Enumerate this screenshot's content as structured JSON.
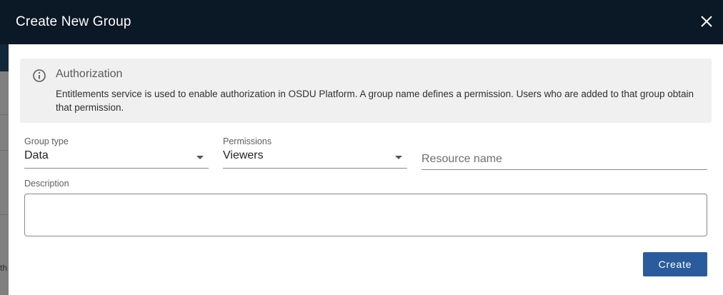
{
  "background": {
    "partial_text": "th"
  },
  "dialog": {
    "title": "Create New Group",
    "close_icon": "close-icon"
  },
  "info": {
    "icon": "info-icon",
    "title": "Authorization",
    "text": "Entitlements service is used to enable authorization in OSDU Platform. A group name defines a permission. Users who are added to that group obtain that permission."
  },
  "form": {
    "group_type": {
      "label": "Group type",
      "value": "Data"
    },
    "permissions": {
      "label": "Permissions",
      "value": "Viewers"
    },
    "resource_name": {
      "placeholder": "Resource name",
      "value": ""
    },
    "description": {
      "label": "Description",
      "value": ""
    }
  },
  "actions": {
    "create_label": "Create"
  },
  "colors": {
    "header": "#0b1826",
    "primary_button": "#2a5b9c",
    "info_background": "#f0f0f0"
  }
}
